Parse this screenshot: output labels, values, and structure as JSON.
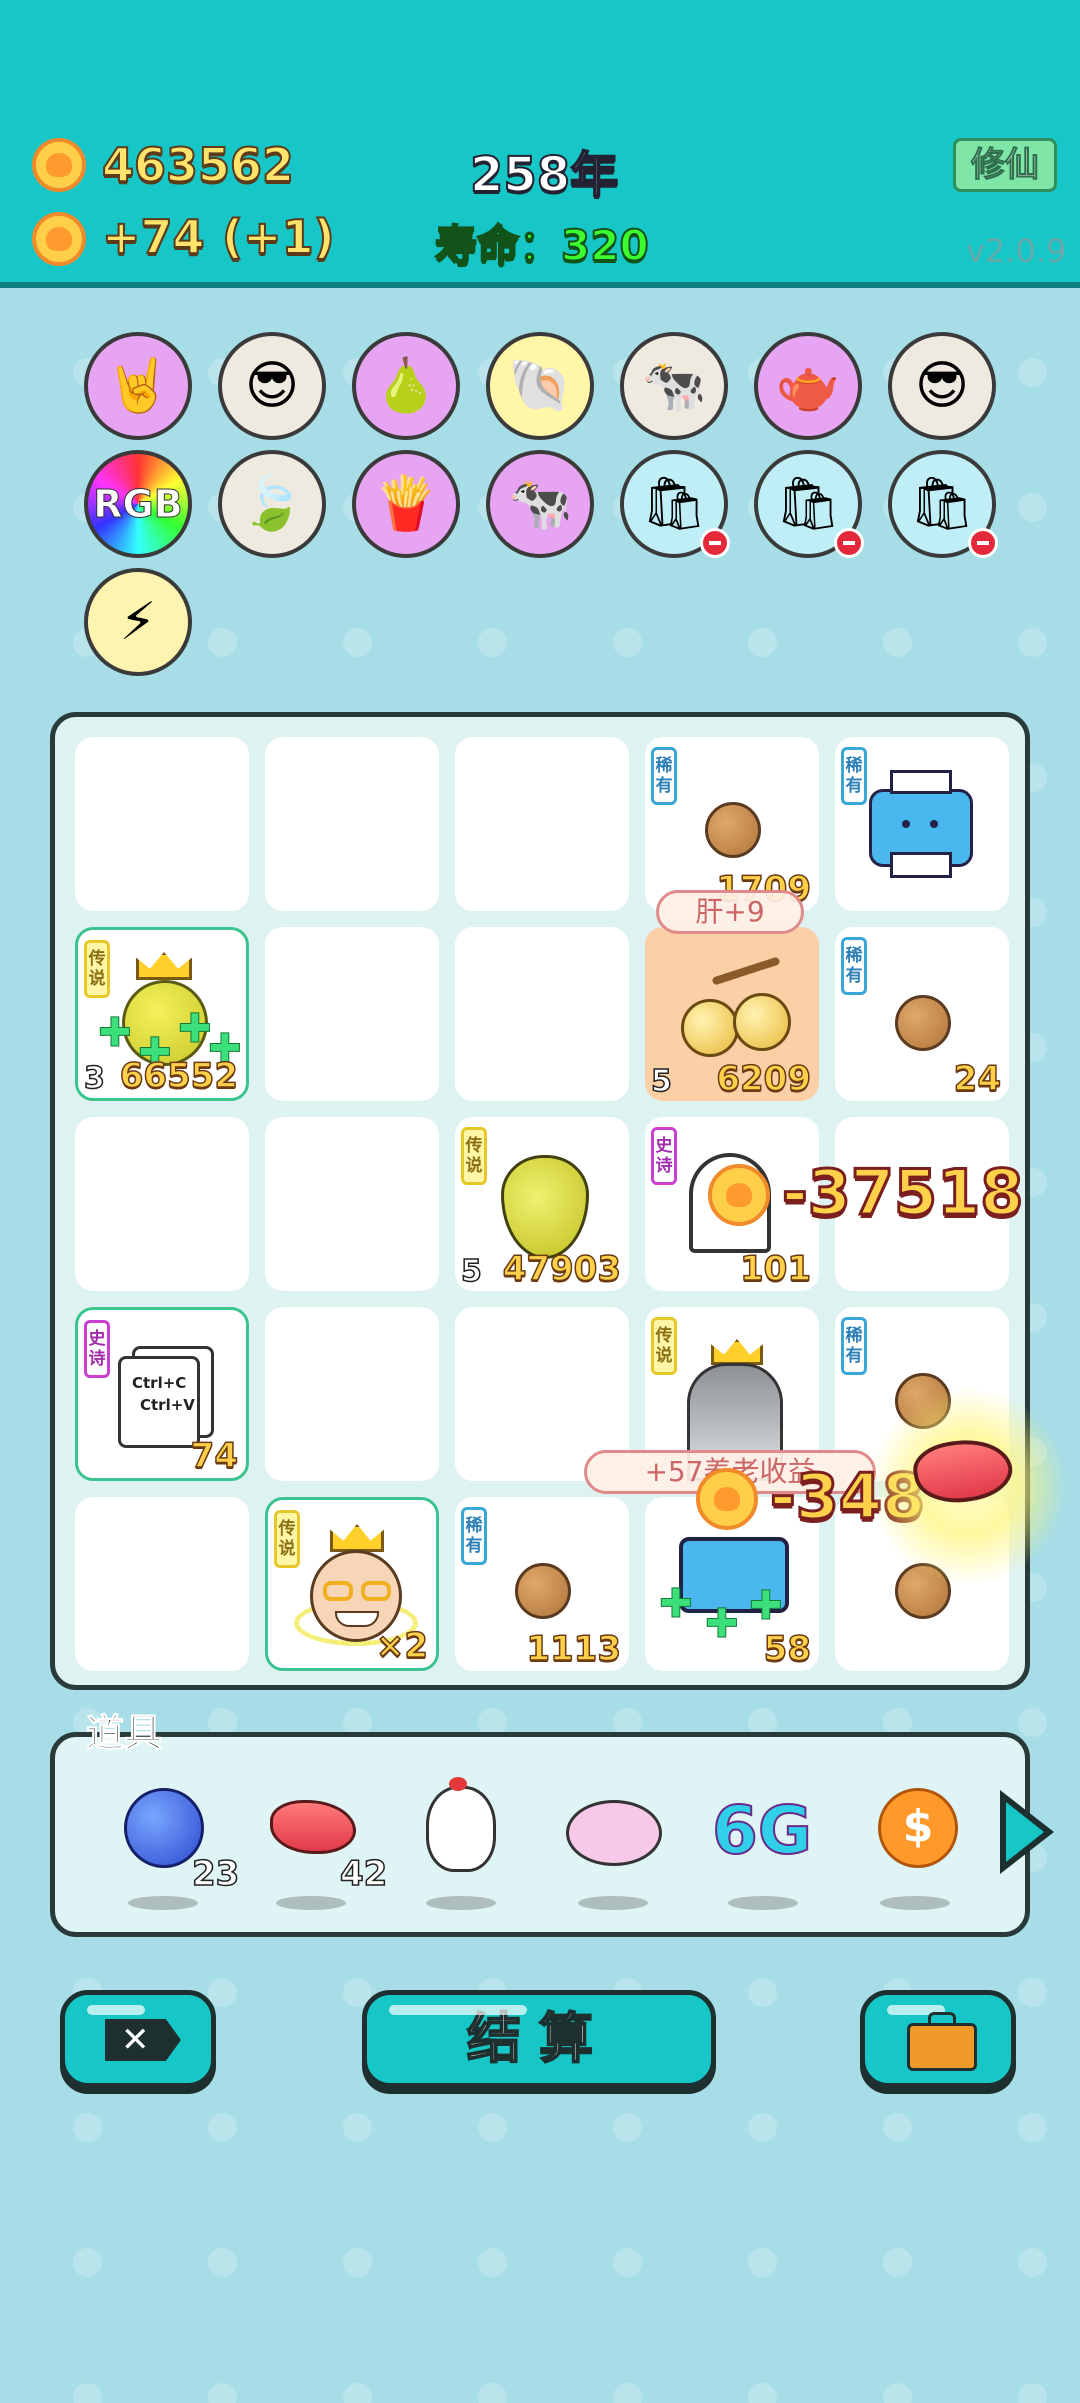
{
  "hud": {
    "coins": "463562",
    "income": "+74",
    "income_bonus": "(+1)",
    "year": "258年",
    "lifespan_label": "寿命：",
    "lifespan_value": "320",
    "cultivate_button": "修仙",
    "version": "v2.0.9"
  },
  "buffs": [
    {
      "icon": "rock-hand-icon",
      "bg": "#e7a4f2"
    },
    {
      "icon": "cat-sunglasses-icon",
      "bg": "#eeeadf"
    },
    {
      "icon": "pomelo-icon",
      "bg": "#e7a4f2"
    },
    {
      "icon": "shell-icon",
      "bg": "#fff6a8"
    },
    {
      "icon": "cows-icon",
      "bg": "#eeeadf"
    },
    {
      "icon": "gravy-boat-icon",
      "bg": "#e7a4f2"
    },
    {
      "icon": "cat-sunglasses-icon",
      "bg": "#eeeadf"
    },
    {
      "icon": "rgb-icon",
      "bg": "#111111"
    },
    {
      "icon": "leaf-icon",
      "bg": "#eeeadf"
    },
    {
      "icon": "fries-icon",
      "bg": "#e7a4f2"
    },
    {
      "icon": "cows-icon",
      "bg": "#e7a4f2"
    },
    {
      "icon": "bag-icon",
      "bg": "#bfeef6"
    },
    {
      "icon": "bag-icon",
      "bg": "#bfeef6"
    },
    {
      "icon": "bag-icon",
      "bg": "#bfeef6"
    },
    {
      "icon": "lightning-icon",
      "bg": "#fff3b0"
    }
  ],
  "grid": {
    "tags": {
      "rare": "稀有",
      "legendary": "传说",
      "epic": "史诗"
    },
    "cells": {
      "r1c4": {
        "num": "1709"
      },
      "r2c1": {
        "level": "3",
        "num": "66552"
      },
      "r2c4": {
        "level": "5",
        "num": "6209"
      },
      "r2c5": {
        "num": "24"
      },
      "r3c3": {
        "level": "5",
        "num": "47903"
      },
      "r3c4": {
        "num": "101"
      },
      "r4c1": {
        "num": "74",
        "copy": "Ctrl+C",
        "paste": "Ctrl+V"
      },
      "r5c2": {
        "num": "×2"
      },
      "r5c3": {
        "num": "1113"
      },
      "r5c4": {
        "num": "58"
      }
    },
    "popup_liver": "肝+9",
    "popup_income": "+57养老收益",
    "float_1": "-37518",
    "float_2": "-348"
  },
  "props": {
    "title": "道具",
    "items": [
      {
        "icon": "blueberry-icon",
        "count": "23"
      },
      {
        "icon": "liver-icon",
        "count": "42"
      },
      {
        "icon": "chicken-icon",
        "count": ""
      },
      {
        "icon": "piggy-bank-icon",
        "count": ""
      },
      {
        "icon": "6g-icon",
        "label": "6G",
        "count": ""
      },
      {
        "icon": "dollar-coin-icon",
        "count": ""
      }
    ]
  },
  "buttons": {
    "settle": "结算"
  }
}
